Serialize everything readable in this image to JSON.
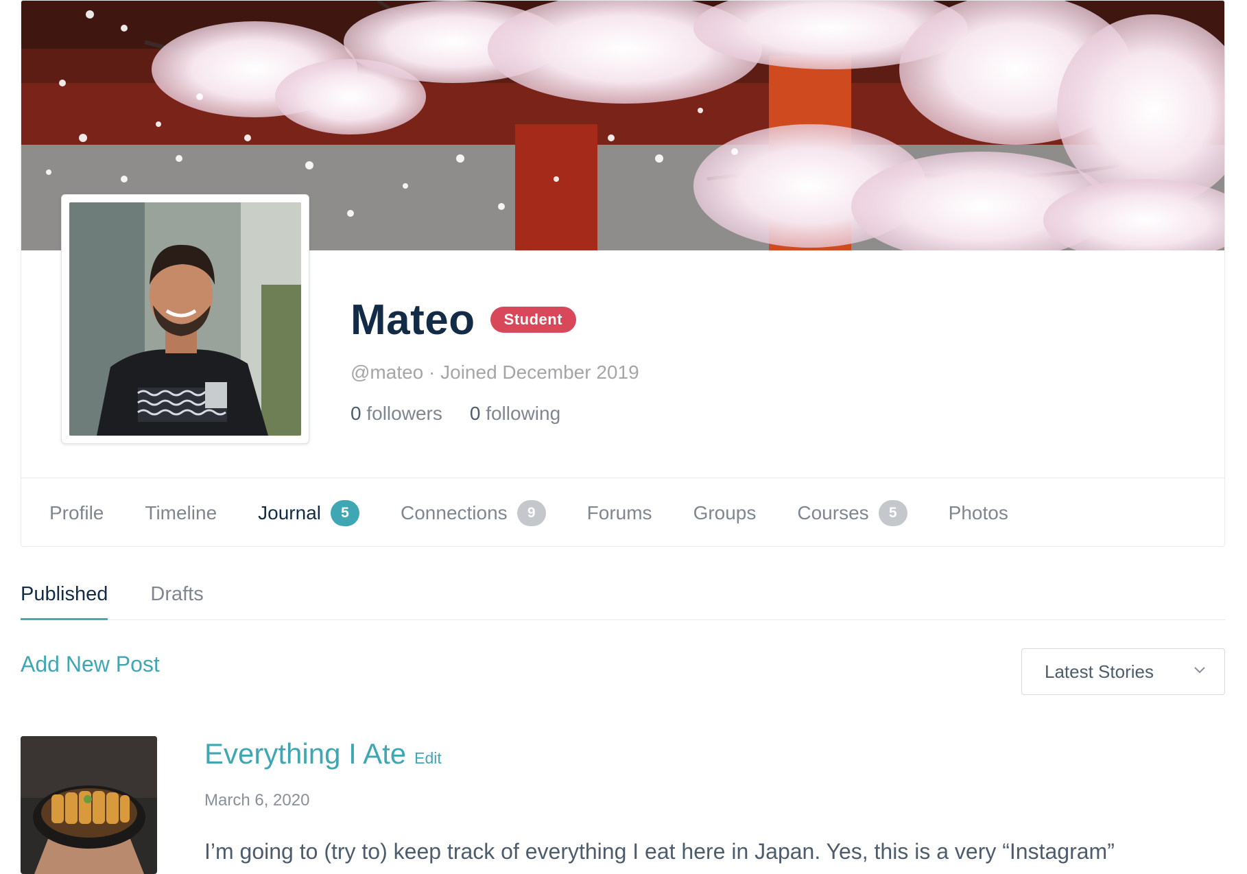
{
  "profile": {
    "name": "Mateo",
    "role_badge": "Student",
    "meta": "@mateo · Joined December 2019",
    "followers_count": "0",
    "followers_label": "followers",
    "following_count": "0",
    "following_label": "following"
  },
  "tabs": [
    {
      "label": "Profile"
    },
    {
      "label": "Timeline"
    },
    {
      "label": "Journal",
      "count": "5",
      "active": true
    },
    {
      "label": "Connections",
      "count": "9"
    },
    {
      "label": "Forums"
    },
    {
      "label": "Groups"
    },
    {
      "label": "Courses",
      "count": "5"
    },
    {
      "label": "Photos"
    }
  ],
  "subtabs": [
    {
      "label": "Published",
      "active": true
    },
    {
      "label": "Drafts"
    }
  ],
  "actions": {
    "add_post": "Add New Post"
  },
  "sort": {
    "selected": "Latest Stories"
  },
  "post": {
    "title": "Everything I Ate",
    "edit_label": "Edit",
    "date": "March 6, 2020",
    "excerpt": "I’m going to (try to) keep track of everything I eat here in Japan. Yes, this is a very “Instagram”"
  },
  "colors": {
    "accent": "#3fa7b4",
    "role_badge": "#d9475a",
    "heading": "#122b46",
    "muted": "#7f868f"
  },
  "icons": {
    "sort_chevron": "chevron-down-icon"
  }
}
